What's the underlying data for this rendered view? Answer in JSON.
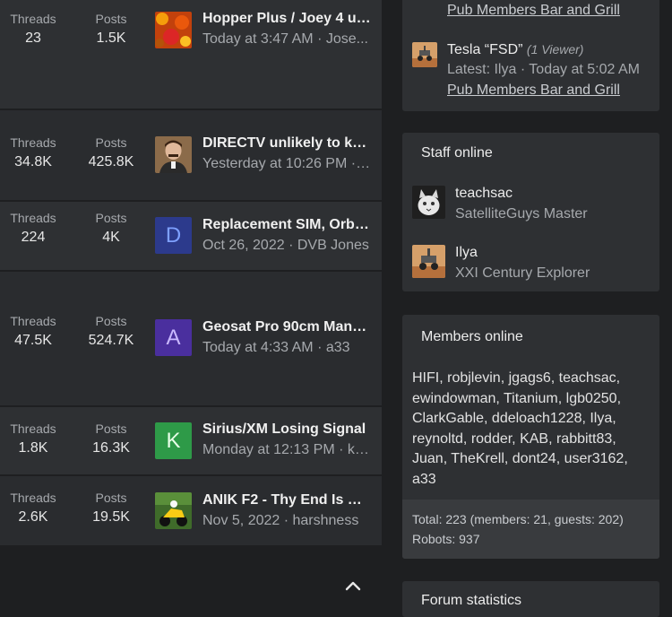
{
  "forums": [
    {
      "threads_label": "Threads",
      "threads": "23",
      "posts_label": "Posts",
      "posts": "1.5K",
      "title": "Hopper Plus / Joey 4 us...",
      "meta": "Today at 3:47 AM · Jose...",
      "avatar_type": "image",
      "avatar_icon": "autumn-leaves-avatar"
    },
    {
      "threads_label": "Threads",
      "threads": "34.8K",
      "posts_label": "Posts",
      "posts": "425.8K",
      "title": "DIRECTV unlikely to kee...",
      "meta": "Yesterday at 10:26 PM · ...",
      "avatar_type": "image",
      "avatar_icon": "portrait-avatar"
    },
    {
      "threads_label": "Threads",
      "threads": "224",
      "posts_label": "Posts",
      "posts": "4K",
      "title": "Replacement SIM, Orby ...",
      "meta": "Oct 26, 2022 · DVB Jones",
      "avatar_type": "letter",
      "avatar_letter": "D",
      "avatar_color": "#2c3a8c",
      "avatar_text_color": "#7ea0ff"
    },
    {
      "threads_label": "Threads",
      "threads": "47.5K",
      "posts_label": "Posts",
      "posts": "524.7K",
      "title": "Geosat Pro 90cm Manu...",
      "meta": "Today at 4:33 AM · a33",
      "avatar_type": "letter",
      "avatar_letter": "A",
      "avatar_color": "#4a2f9e",
      "avatar_text_color": "#c9b8ff"
    },
    {
      "threads_label": "Threads",
      "threads": "1.8K",
      "posts_label": "Posts",
      "posts": "16.3K",
      "title": "Sirius/XM Losing Signal",
      "meta": "Monday at 12:13 PM · ks...",
      "avatar_type": "letter",
      "avatar_letter": "K",
      "avatar_color": "#2e9a48",
      "avatar_text_color": "#e8ffe8"
    },
    {
      "threads_label": "Threads",
      "threads": "2.6K",
      "posts_label": "Posts",
      "posts": "19.5K",
      "title": "ANIK F2 - Thy End Is Ne...",
      "meta": "Nov 5, 2022 · harshness",
      "avatar_type": "image",
      "avatar_icon": "motorbike-avatar"
    }
  ],
  "latest_block": {
    "top_link": "Pub Members Bar and Grill",
    "thread_title": "Tesla “FSD”",
    "viewers": "(1 Viewer)",
    "latest": "Latest: Ilya · Today at 5:02 AM",
    "forum_link": "Pub Members Bar and Grill"
  },
  "staff_online": {
    "heading": "Staff online",
    "members": [
      {
        "name": "teachsac",
        "title": "SatelliteGuys Master",
        "avatar_icon": "cat-avatar"
      },
      {
        "name": "Ilya",
        "title": "XXI Century Explorer",
        "avatar_icon": "mars-rover-avatar"
      }
    ]
  },
  "members_online": {
    "heading": "Members online",
    "list": "HIFI, robjlevin, jgags6, teachsac, ewindowman, Titanium, lgb0250, ClarkGable, ddeloach1228, Ilya, reynoltd, rodder, KAB, rabbitt83, Juan, TheKrell, dont24, user3162, a33",
    "total": "Total: 223 (members: 21, guests: 202)",
    "robots": "Robots: 937"
  },
  "forum_statistics": {
    "heading": "Forum statistics"
  },
  "icons": {
    "scroll_top": "chevron-up-icon"
  }
}
